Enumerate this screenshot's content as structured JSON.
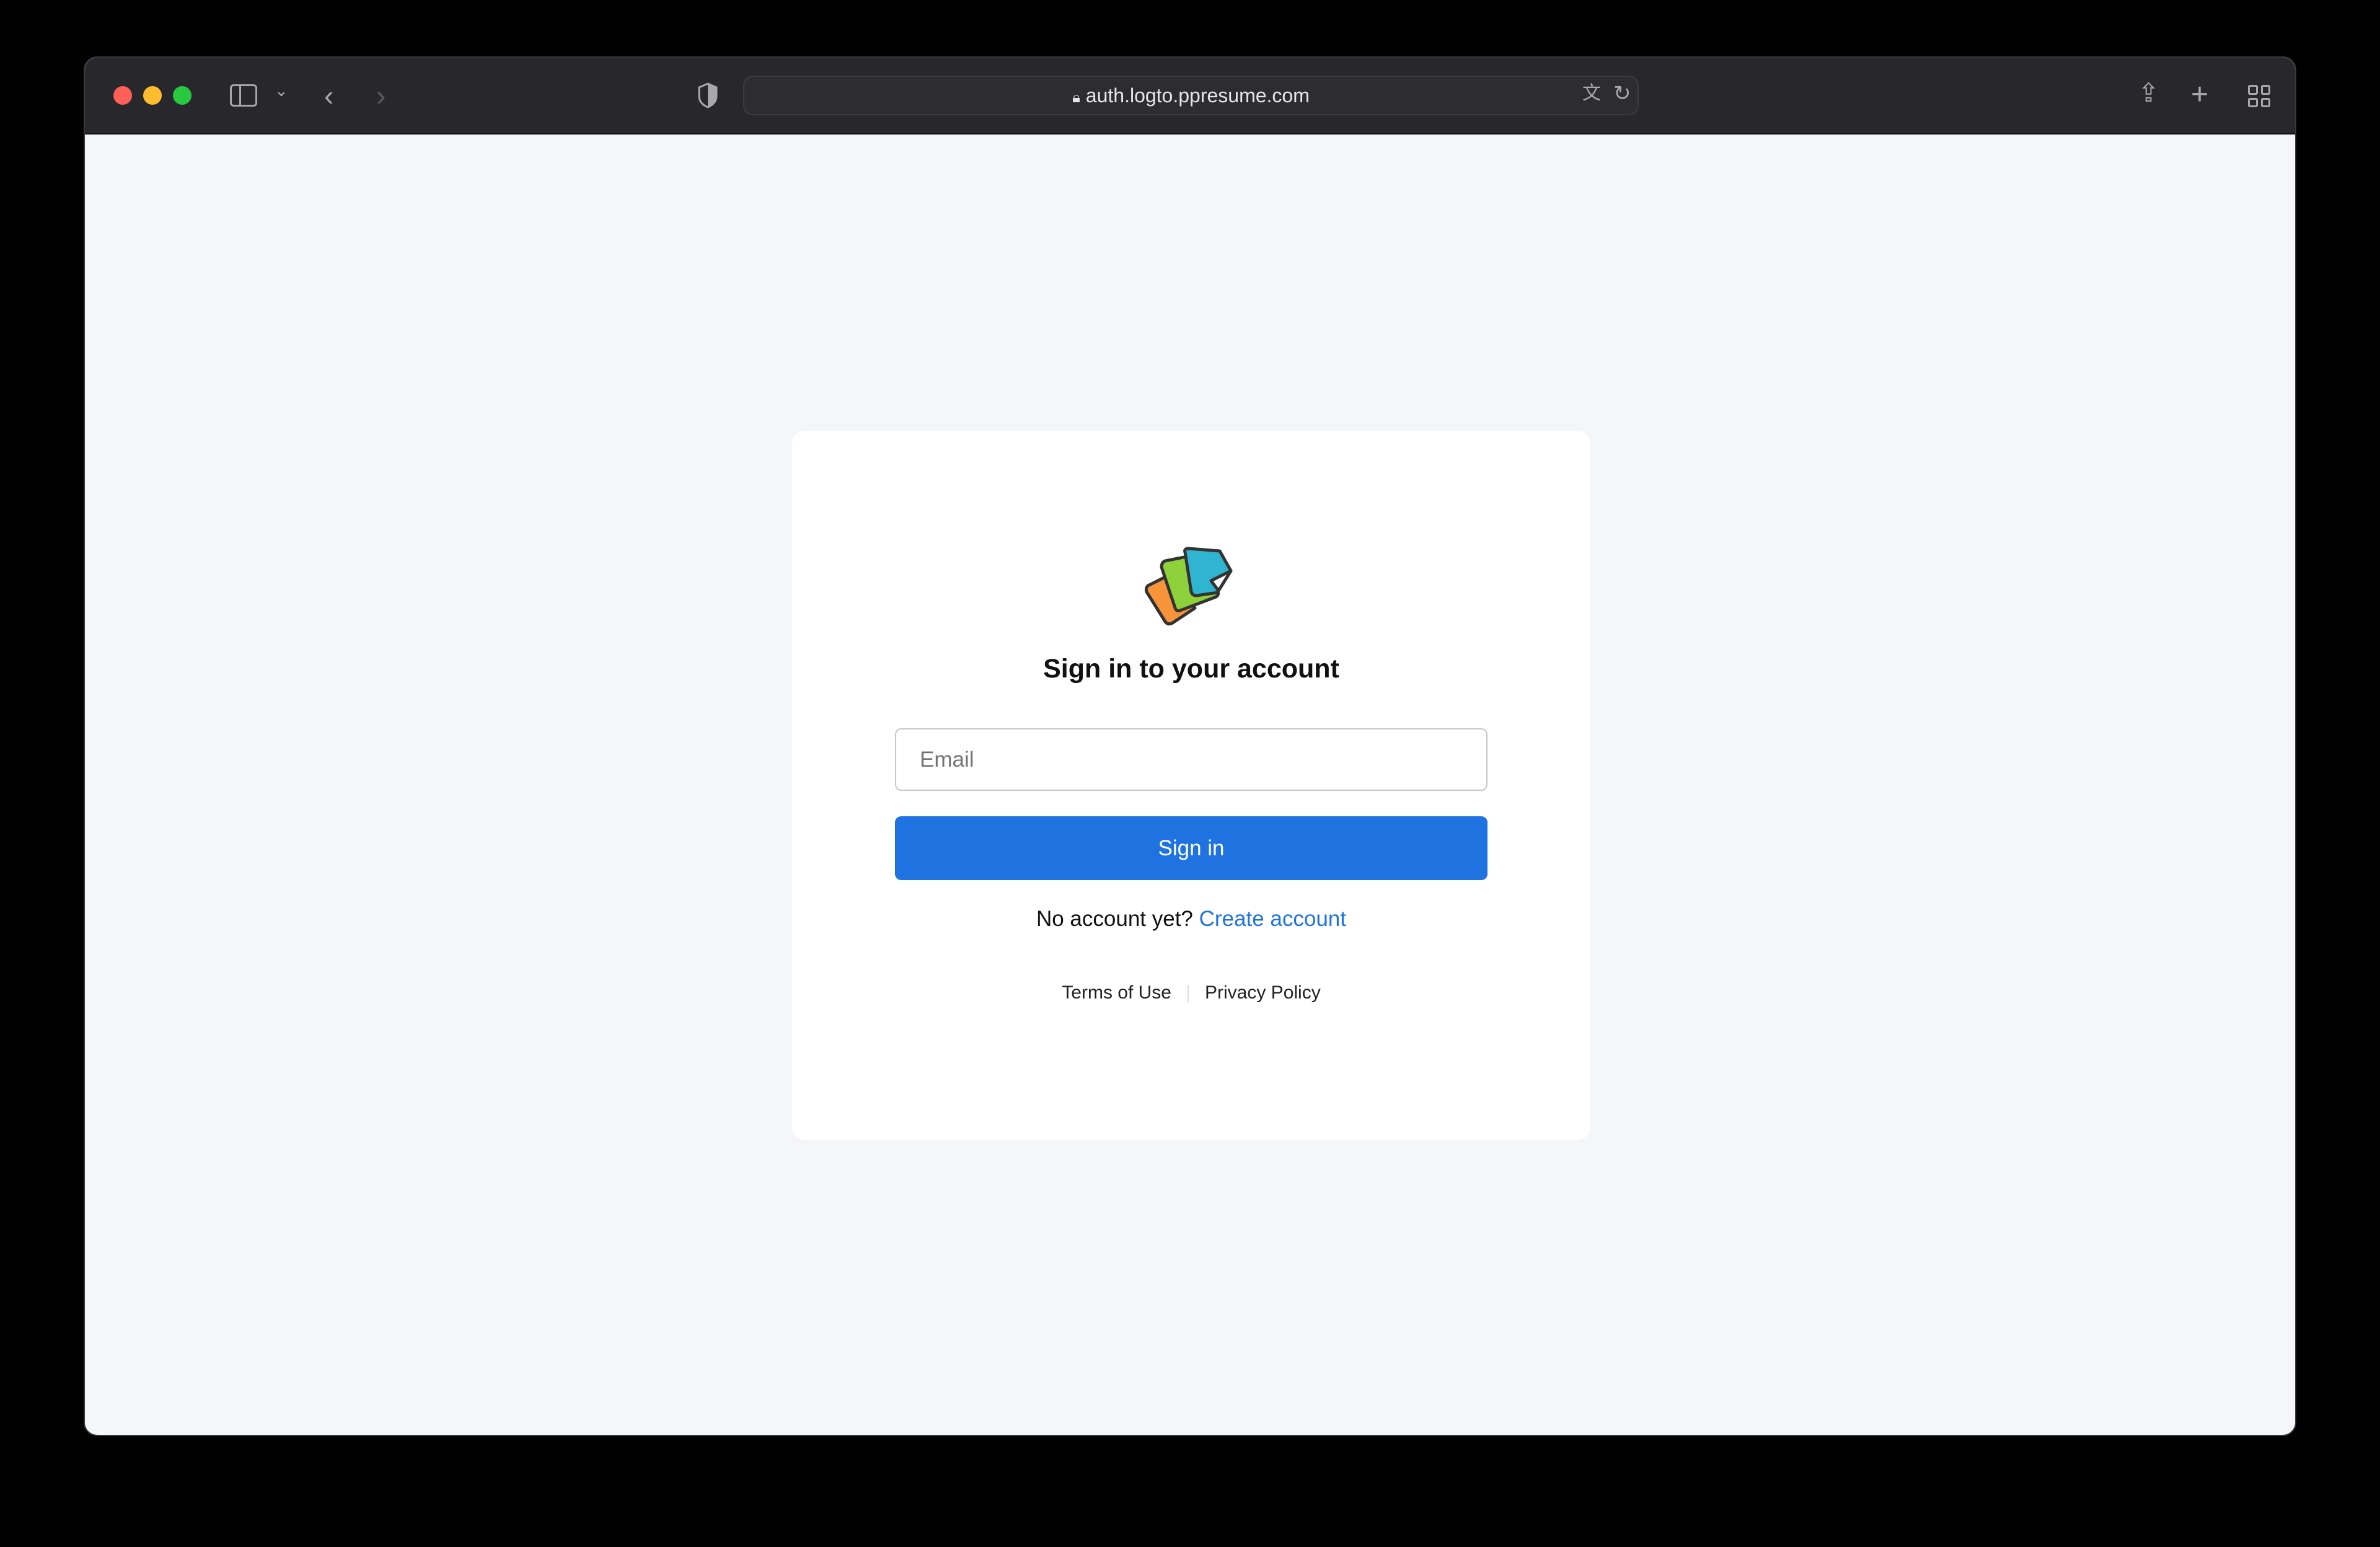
{
  "browser": {
    "url": "auth.logto.ppresume.com",
    "icons": [
      "close-window",
      "minimize-window",
      "maximize-window",
      "sidebar-icon",
      "chevron-down-icon",
      "back-icon",
      "forward-icon",
      "privacy-shield-icon",
      "lock-icon",
      "translate-icon",
      "reload-icon",
      "share-icon",
      "new-tab-icon",
      "tab-overview-icon"
    ]
  },
  "signin": {
    "title": "Sign in to your account",
    "email_placeholder": "Email",
    "submit_label": "Sign in",
    "no_account_text": "No account yet?",
    "create_account_label": "Create account",
    "terms_label": "Terms of Use",
    "privacy_label": "Privacy Policy"
  },
  "colors": {
    "primary": "#1f73e0",
    "page_bg": "#f5f6f8",
    "toolbar_bg": "#28272c"
  }
}
